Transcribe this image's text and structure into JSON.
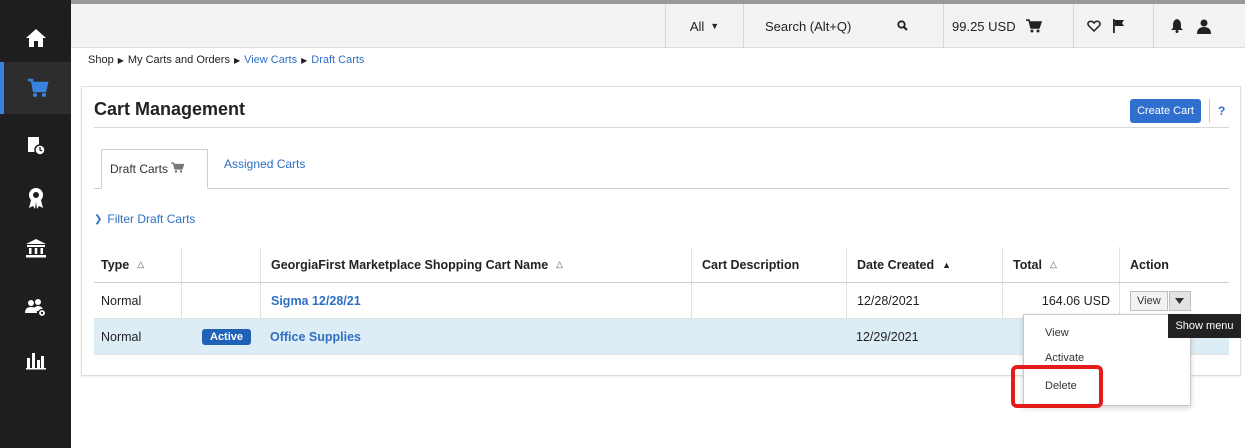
{
  "sidebar": {
    "items": [
      {
        "icon": "home-icon"
      },
      {
        "icon": "cart-icon",
        "active": true
      },
      {
        "icon": "document-clock-icon"
      },
      {
        "icon": "award-icon"
      },
      {
        "icon": "bank-icon"
      },
      {
        "icon": "users-gear-icon"
      },
      {
        "icon": "bar-chart-icon"
      }
    ]
  },
  "topbar": {
    "scope_label": "All",
    "search_placeholder": "Search (Alt+Q)",
    "cart_total": "99.25 USD"
  },
  "breadcrumb": {
    "items": [
      "Shop",
      "My Carts and Orders",
      "View Carts",
      "Draft Carts"
    ]
  },
  "page": {
    "title": "Cart Management",
    "create_button": "Create Cart",
    "help": "?"
  },
  "tabs": {
    "draft": "Draft Carts",
    "assigned": "Assigned Carts"
  },
  "filter_label": "Filter Draft Carts",
  "table": {
    "headers": {
      "type": "Type",
      "name": "GeorgiaFirst Marketplace Shopping Cart Name",
      "description": "Cart Description",
      "date": "Date Created",
      "total": "Total",
      "action": "Action"
    },
    "rows": [
      {
        "type": "Normal",
        "badge": "",
        "name": "Sigma 12/28/21",
        "description": "",
        "date": "12/28/2021",
        "total": "164.06 USD",
        "view": "View"
      },
      {
        "type": "Normal",
        "badge": "Active",
        "name": "Office Supplies",
        "description": "",
        "date": "12/29/2021",
        "total": "",
        "view": ""
      }
    ]
  },
  "dropdown": {
    "items": [
      "View",
      "Activate",
      "Delete"
    ]
  },
  "tooltip": "Show menu",
  "colors": {
    "accent": "#2f6fd0",
    "highlight_row": "#ddedf6",
    "annotation": "#e51b1b",
    "sidebar": "#1e1e1e"
  }
}
